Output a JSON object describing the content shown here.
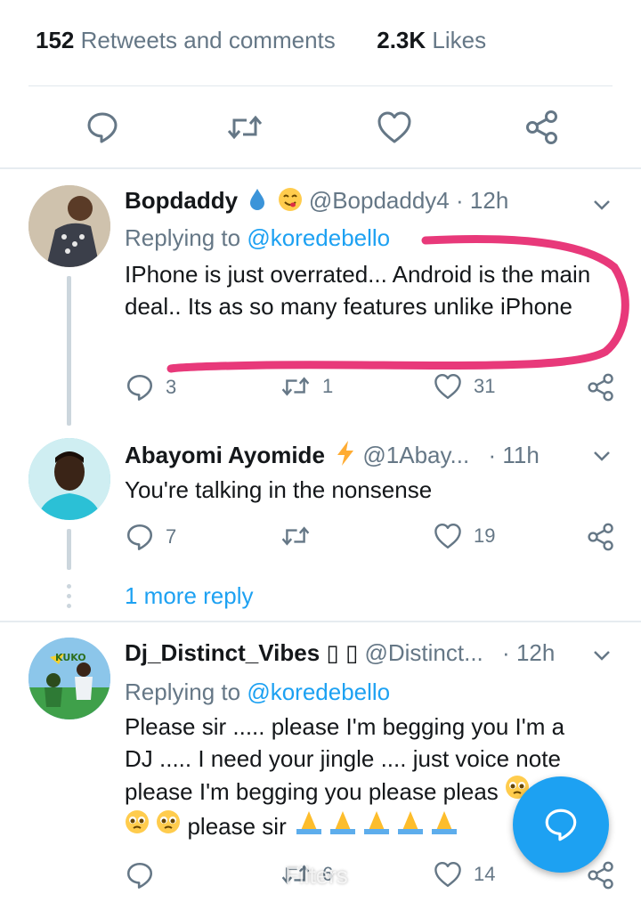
{
  "stats": {
    "retweets_count": "152",
    "retweets_label": "Retweets and comments",
    "likes_count": "2.3K",
    "likes_label": "Likes"
  },
  "colors": {
    "accent": "#1da1f2",
    "annotation": "#e8397a",
    "secondary_text": "#657786"
  },
  "main_actions": [
    "reply-icon",
    "retweet-icon",
    "like-icon",
    "share-icon"
  ],
  "replies": [
    {
      "name": "Bopdaddy",
      "emojis": [
        "droplet-emoji",
        "yum-emoji"
      ],
      "handle": "@Bopdaddy4",
      "dot": "·",
      "time": "12h",
      "replying_prefix": "Replying to",
      "replying_to": "@koredebello",
      "text": "IPhone is just overrated... Android is the main deal.. Its as so many features unlike iPhone",
      "replies": "3",
      "retweets": "1",
      "likes": "31"
    },
    {
      "name": "Abayomi Ayomide",
      "emojis": [
        "zap-emoji"
      ],
      "handle": "@1Abay...",
      "dot": "·",
      "time": "11h",
      "text": "You're talking in the nonsense",
      "replies": "7",
      "retweets": "",
      "likes": "19"
    },
    {
      "name": "Dj_Distinct_Vibes",
      "name_suffix": "▯ ▯",
      "handle": "@Distinct...",
      "dot": "·",
      "time": "12h",
      "replying_prefix": "Replying to",
      "replying_to": "@koredebello",
      "text_line1": "Please sir ..... please I'm begging you I'm a",
      "text_line2": "DJ ..... I need your jingle .... just voice note",
      "text_line3": "please I'm begging you please pleas",
      "text_line4": "please sir",
      "replies": "",
      "retweets": "6",
      "likes": "14"
    }
  ],
  "more_reply": "1 more reply",
  "overlay": {
    "filters_label": "Filters",
    "fab_icon": "compose-reply-icon"
  }
}
